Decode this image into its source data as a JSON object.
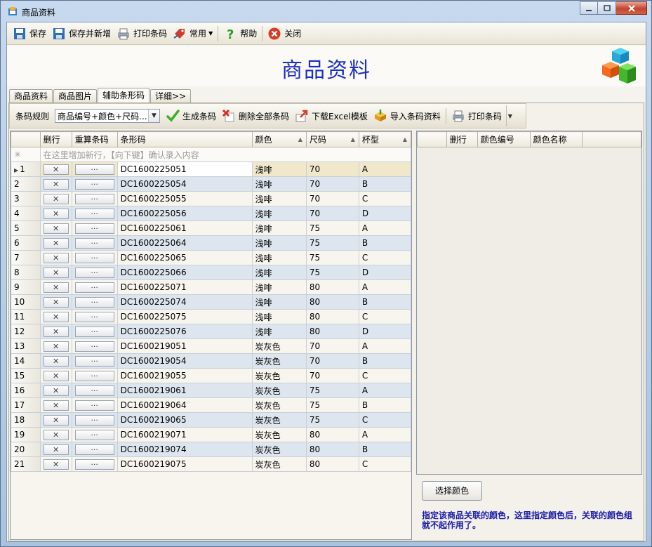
{
  "window": {
    "title": "商品资料"
  },
  "toolbar": {
    "save": "保存",
    "save_new": "保存并新增",
    "print_barcode": "打印条码",
    "common": "常用",
    "help": "帮助",
    "close": "关闭"
  },
  "banner": {
    "title": "商品资料"
  },
  "tabs": [
    "商品资料",
    "商品图片",
    "辅助条形码",
    "详细>>"
  ],
  "subtoolbar": {
    "rule_label": "条码规则",
    "rule_value": "商品编号+颜色+尺码...",
    "generate": "生成条码",
    "delete_all": "删除全部条码",
    "download_excel": "下载Excel模板",
    "import": "导入条码资料",
    "print": "打印条码"
  },
  "grid": {
    "columns": [
      "删行",
      "重算条码",
      "条形码",
      "颜色",
      "尺码",
      "杯型"
    ],
    "new_row_hint": "在这里增加新行，【向下键】确认录入内容",
    "delete_glyph": "✕",
    "recalc_glyph": "···",
    "rows": [
      {
        "no": "1",
        "barcode": "DC1600225051",
        "color": "浅啡",
        "size": "70",
        "cup": "A"
      },
      {
        "no": "2",
        "barcode": "DC1600225054",
        "color": "浅啡",
        "size": "70",
        "cup": "B"
      },
      {
        "no": "3",
        "barcode": "DC1600225055",
        "color": "浅啡",
        "size": "70",
        "cup": "C"
      },
      {
        "no": "4",
        "barcode": "DC1600225056",
        "color": "浅啡",
        "size": "70",
        "cup": "D"
      },
      {
        "no": "5",
        "barcode": "DC1600225061",
        "color": "浅啡",
        "size": "75",
        "cup": "A"
      },
      {
        "no": "6",
        "barcode": "DC1600225064",
        "color": "浅啡",
        "size": "75",
        "cup": "B"
      },
      {
        "no": "7",
        "barcode": "DC1600225065",
        "color": "浅啡",
        "size": "75",
        "cup": "C"
      },
      {
        "no": "8",
        "barcode": "DC1600225066",
        "color": "浅啡",
        "size": "75",
        "cup": "D"
      },
      {
        "no": "9",
        "barcode": "DC1600225071",
        "color": "浅啡",
        "size": "80",
        "cup": "A"
      },
      {
        "no": "10",
        "barcode": "DC1600225074",
        "color": "浅啡",
        "size": "80",
        "cup": "B"
      },
      {
        "no": "11",
        "barcode": "DC1600225075",
        "color": "浅啡",
        "size": "80",
        "cup": "C"
      },
      {
        "no": "12",
        "barcode": "DC1600225076",
        "color": "浅啡",
        "size": "80",
        "cup": "D"
      },
      {
        "no": "13",
        "barcode": "DC1600219051",
        "color": "炭灰色",
        "size": "70",
        "cup": "A"
      },
      {
        "no": "14",
        "barcode": "DC1600219054",
        "color": "炭灰色",
        "size": "70",
        "cup": "B"
      },
      {
        "no": "15",
        "barcode": "DC1600219055",
        "color": "炭灰色",
        "size": "70",
        "cup": "C"
      },
      {
        "no": "16",
        "barcode": "DC1600219061",
        "color": "炭灰色",
        "size": "75",
        "cup": "A"
      },
      {
        "no": "17",
        "barcode": "DC1600219064",
        "color": "炭灰色",
        "size": "75",
        "cup": "B"
      },
      {
        "no": "18",
        "barcode": "DC1600219065",
        "color": "炭灰色",
        "size": "75",
        "cup": "C"
      },
      {
        "no": "19",
        "barcode": "DC1600219071",
        "color": "炭灰色",
        "size": "80",
        "cup": "A"
      },
      {
        "no": "20",
        "barcode": "DC1600219074",
        "color": "炭灰色",
        "size": "80",
        "cup": "B"
      },
      {
        "no": "21",
        "barcode": "DC1600219075",
        "color": "炭灰色",
        "size": "80",
        "cup": "C"
      }
    ]
  },
  "color_grid": {
    "columns": [
      "删行",
      "颜色编号",
      "颜色名称"
    ]
  },
  "select_color": "选择颜色",
  "note": "指定该商品关联的颜色，这里指定颜色后，关联的颜色组就不起作用了。",
  "colors": {
    "title_blue": "#1a2fbf",
    "note_blue": "#1a1aa8",
    "row_alt": "#dde6ee",
    "row_selected": "#f1e8cc"
  }
}
